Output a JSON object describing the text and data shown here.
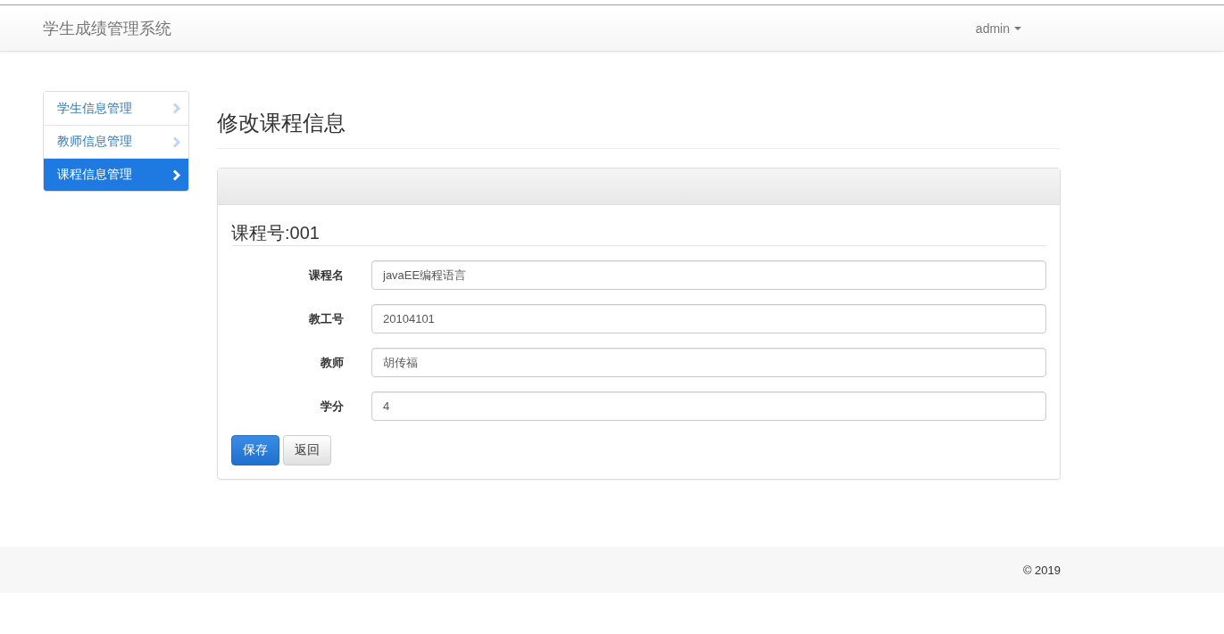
{
  "navbar": {
    "brand": "学生成绩管理系统",
    "user": "admin"
  },
  "sidebar": {
    "items": [
      {
        "label": "学生信息管理",
        "selected": false
      },
      {
        "label": "教师信息管理",
        "selected": false
      },
      {
        "label": "课程信息管理",
        "selected": true
      }
    ]
  },
  "page_title": "修改课程信息",
  "panel": {
    "subtitle": "课程号:001",
    "fields": [
      {
        "label": "课程名",
        "value": "javaEE编程语言"
      },
      {
        "label": "教工号",
        "value": "20104101"
      },
      {
        "label": "教师",
        "value": "胡传福"
      },
      {
        "label": "学分",
        "value": "4"
      }
    ],
    "buttons": [
      {
        "label": "保存",
        "kind": "primary"
      },
      {
        "label": "返回",
        "kind": "default"
      }
    ]
  },
  "footer": {
    "copyright": "© 2019"
  }
}
